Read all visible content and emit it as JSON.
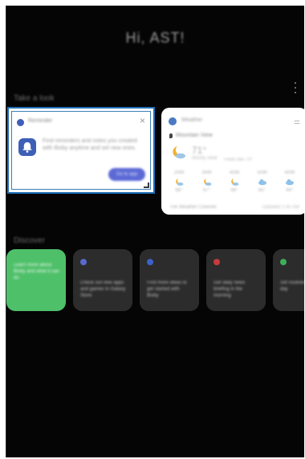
{
  "greeting": "Hi, AST!",
  "sections": {
    "take_a_look": "Take a look",
    "discover": "Discover"
  },
  "reminder_card": {
    "app_name": "Reminder",
    "text": "Find reminders and notes you created with Bixby anytime and set new ones.",
    "button_label": "Go to app"
  },
  "weather_card": {
    "app_name": "Weather",
    "location": "Mountain View",
    "temperature": "71°",
    "description": "Mostly clear",
    "extra": "Feels like 70°",
    "forecast": [
      {
        "time": "2AM",
        "temp": "68°",
        "icon": "moon-cloud-icon"
      },
      {
        "time": "3AM",
        "temp": "67°",
        "icon": "moon-cloud-icon"
      },
      {
        "time": "4AM",
        "temp": "66°",
        "icon": "moon-cloud-icon"
      },
      {
        "time": "5AM",
        "temp": "65°",
        "icon": "cloud-icon"
      },
      {
        "time": "6AM",
        "temp": "64°",
        "icon": "cloud-icon"
      }
    ],
    "footer_left": "The Weather Channel",
    "footer_right": "Updated 1:45 AM"
  },
  "discover_cards": [
    {
      "text": "Learn more about Bixby and what it can do",
      "color": "#4fc06a",
      "dot": ""
    },
    {
      "text": "Check out new apps and games in Galaxy Store",
      "color": "#2c2c2c",
      "dot": "#5a6ad0"
    },
    {
      "text": "Find more ideas to get started with Bixby",
      "color": "#2c2c2c",
      "dot": "#3c62c8"
    },
    {
      "text": "Get daily news briefing in the morning",
      "color": "#2c2c2c",
      "dot": "#c83b3b"
    },
    {
      "text": "Set routines for your day",
      "color": "#2c2c2c",
      "dot": "#3fae5a"
    }
  ],
  "colors": {
    "background": "#050505",
    "highlight": "#1d6fb8",
    "accent": "#5c6ad6"
  }
}
